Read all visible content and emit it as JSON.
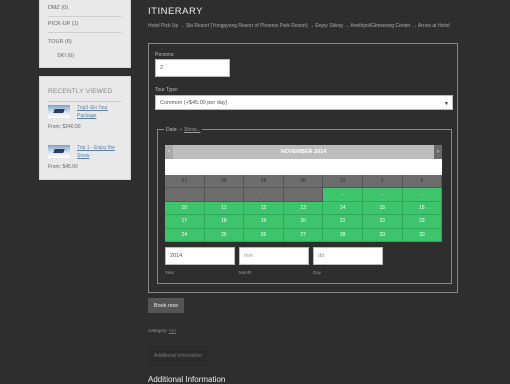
{
  "sidebar": {
    "categories": [
      {
        "label": "DMZ (0)"
      },
      {
        "label": "PICK-UP (1)"
      },
      {
        "label": "TOUR (6)"
      },
      {
        "label": "SKI (6)"
      }
    ],
    "recently_viewed": {
      "title": "RECENTLY VIEWED",
      "items": [
        {
          "name": "Trip3-Ski Tour Package",
          "price": "From: $240.00"
        },
        {
          "name": "Trip 1 - Enjoy the Snow",
          "price": "From: $45.00"
        }
      ]
    }
  },
  "main": {
    "title": "ITINERARY",
    "itinerary": "Hotel Pick Up → Ski Resort (Yongpyong Resort of Phoenix Park Resort) → Enjoy Skiing → Anetbyol/Gimseong Center → Arrive at Hotel",
    "persons_label": "Persons:",
    "persons_value": "2",
    "tour_type_label": "Tour Type:",
    "tour_type_value": "Common (+$45.00 per day)",
    "date_label": "Date:",
    "date_show": "Show...",
    "calendar": {
      "month": "NOVEMBER 2014",
      "prev": "‹",
      "next": "›",
      "weekday_row": [
        "",
        "",
        "",
        "",
        "",
        "",
        ""
      ],
      "weeks": [
        {
          "days": [
            "27",
            "28",
            "29",
            "30",
            "31",
            "1",
            "2"
          ],
          "avail": [
            false,
            false,
            false,
            false,
            false,
            false,
            false
          ]
        },
        {
          "days": [
            "-",
            "-",
            "-",
            "-",
            "-",
            "-",
            "-"
          ],
          "avail": [
            false,
            false,
            false,
            false,
            true,
            true,
            true
          ]
        },
        {
          "days": [
            "10",
            "11",
            "12",
            "13",
            "14",
            "15",
            "16"
          ],
          "avail": [
            true,
            true,
            true,
            true,
            true,
            true,
            true
          ]
        },
        {
          "days": [
            "17",
            "18",
            "19",
            "20",
            "21",
            "22",
            "23"
          ],
          "avail": [
            true,
            true,
            true,
            true,
            true,
            true,
            true
          ]
        },
        {
          "days": [
            "24",
            "25",
            "26",
            "27",
            "28",
            "29",
            "30"
          ],
          "avail": [
            true,
            true,
            true,
            true,
            true,
            true,
            true
          ]
        }
      ]
    },
    "year_value": "2014",
    "month_placeholder": "mm",
    "day_placeholder": "dd",
    "year_label": "Year",
    "month_label": "Month",
    "day_label": "Day",
    "book_button": "Book now",
    "category_prefix": "Category:",
    "category_value": "SKI",
    "tab_additional": "Additional Information",
    "additional_heading": "Additional Information"
  },
  "colors": {
    "available": "#3ec46d",
    "unavailable": "#6d6d6d",
    "page_bg": "#2e2e2e"
  }
}
